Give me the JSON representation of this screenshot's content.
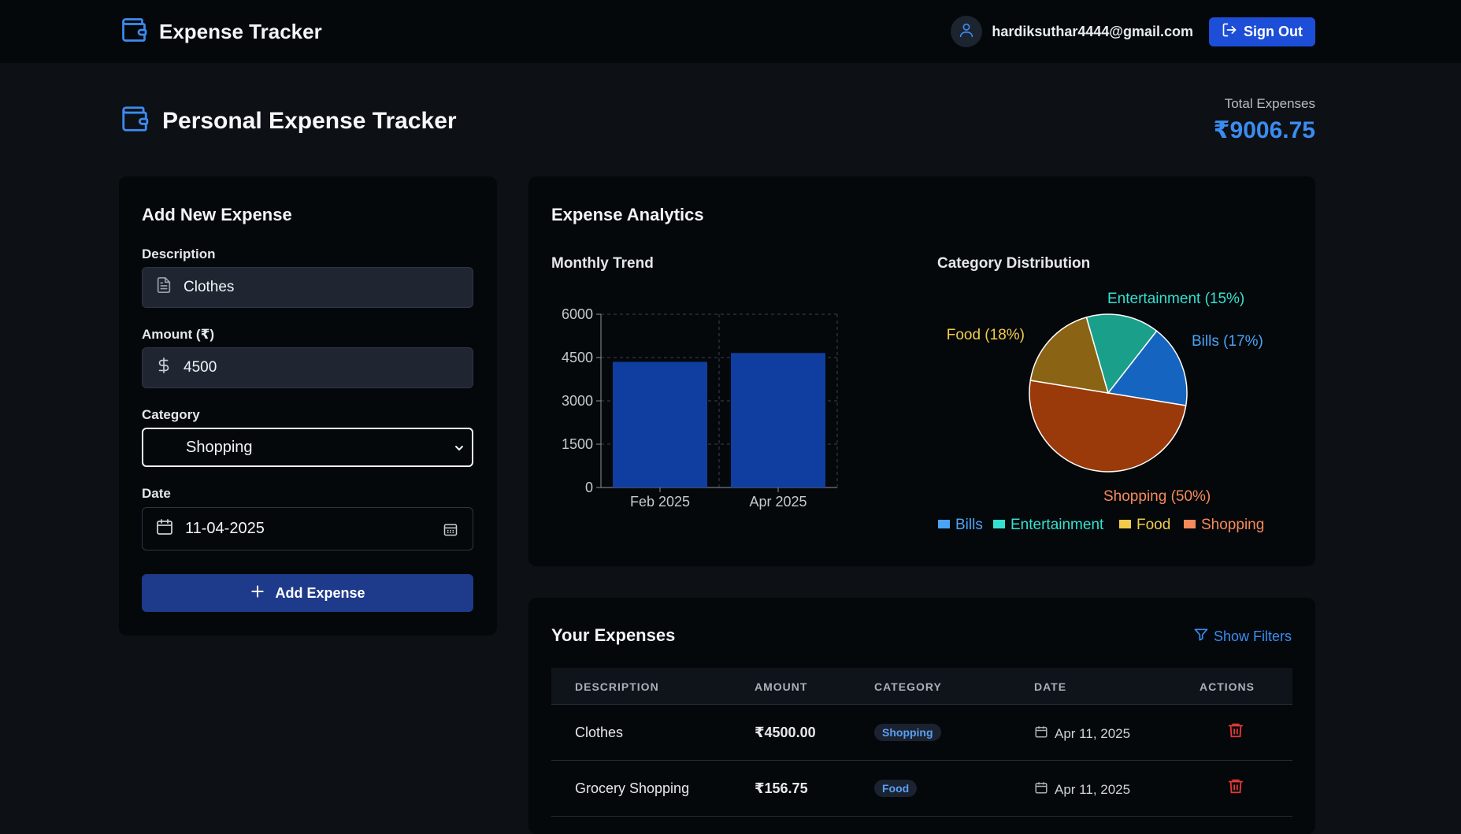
{
  "nav": {
    "brand": "Expense Tracker",
    "user_email": "hardiksuthar4444@gmail.com",
    "signout_label": "Sign Out"
  },
  "header": {
    "title": "Personal Expense Tracker",
    "total_label": "Total Expenses",
    "total_value": "₹9006.75"
  },
  "form": {
    "title": "Add New Expense",
    "description_label": "Description",
    "description_value": "Clothes",
    "amount_label": "Amount (₹)",
    "amount_value": "4500",
    "category_label": "Category",
    "category_value": "Shopping",
    "date_label": "Date",
    "date_value": "11-04-2025",
    "submit_label": "Add Expense"
  },
  "analytics": {
    "title": "Expense Analytics",
    "monthly_title": "Monthly Trend",
    "category_title": "Category Distribution"
  },
  "chart_data": [
    {
      "type": "bar",
      "title": "Monthly Trend",
      "categories": [
        "Feb 2025",
        "Apr 2025"
      ],
      "values": [
        4350,
        4656.75
      ],
      "y_ticks": [
        "0",
        "1500",
        "3000",
        "4500",
        "6000"
      ],
      "ylim": [
        0,
        6000
      ],
      "grid": true,
      "color": "#0f3ea0"
    },
    {
      "type": "pie",
      "title": "Category Distribution",
      "slices": [
        {
          "name": "Bills",
          "percent": 17,
          "label": "Bills (17%)",
          "color": "#1565c0",
          "label_color": "#4aa3f5"
        },
        {
          "name": "Entertainment",
          "percent": 15,
          "label": "Entertainment (15%)",
          "color": "#1aa08a",
          "label_color": "#35e0d0"
        },
        {
          "name": "Food",
          "percent": 18,
          "label": "Food (18%)",
          "color": "#8a6414",
          "label_color": "#f2cc4a"
        },
        {
          "name": "Shopping",
          "percent": 50,
          "label": "Shopping (50%)",
          "color": "#9a3a0a",
          "label_color": "#f58a5a"
        }
      ],
      "legend": [
        "Bills",
        "Entertainment",
        "Food",
        "Shopping"
      ],
      "legend_placement": "bottom"
    }
  ],
  "expenses": {
    "title": "Your Expenses",
    "show_filters_label": "Show Filters",
    "columns": [
      "DESCRIPTION",
      "AMOUNT",
      "CATEGORY",
      "DATE",
      "ACTIONS"
    ],
    "rows": [
      {
        "description": "Clothes",
        "amount": "₹4500.00",
        "category": "Shopping",
        "date": "Apr 11, 2025"
      },
      {
        "description": "Grocery Shopping",
        "amount": "₹156.75",
        "category": "Food",
        "date": "Apr 11, 2025"
      }
    ]
  },
  "colors": {
    "accent": "#3b8cf0",
    "primary_button": "#1d4ed8",
    "delete": "#e53935"
  }
}
